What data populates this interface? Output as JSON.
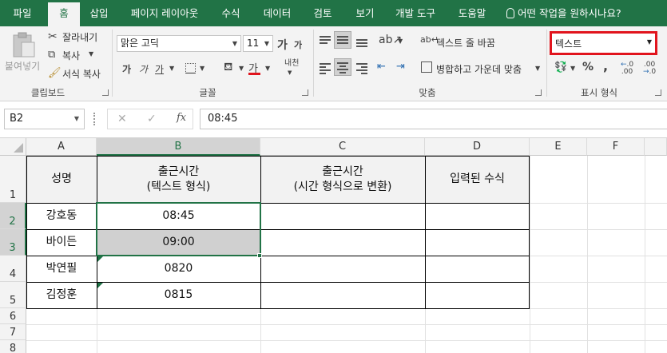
{
  "tabs": [
    "파일",
    "홈",
    "삽입",
    "페이지 레이아웃",
    "수식",
    "데이터",
    "검토",
    "보기",
    "개발 도구",
    "도움말"
  ],
  "active_tab": "홈",
  "tell_me": "어떤 작업을 원하시나요?",
  "clipboard": {
    "paste": "붙여넣기",
    "cut": "잘라내기",
    "copy": "복사",
    "format_painter": "서식 복사",
    "group": "클립보드"
  },
  "font": {
    "name": "맑은 고딕",
    "size": "11",
    "grow": "가",
    "shrink": "가",
    "bold": "가",
    "italic": "가",
    "underline": "가",
    "font_color": "가",
    "phonetic": "내천",
    "group": "글꼴"
  },
  "alignment": {
    "wrap_text": "텍스트 줄 바꿈",
    "merge_center": "병합하고 가운데 맞춤",
    "group": "맞춤"
  },
  "number": {
    "format": "텍스트",
    "percent": "%",
    "comma": ",",
    "inc_decimal": ".00",
    "dec_decimal": ".0",
    "group": "표시 형식"
  },
  "formula_bar": {
    "name_box": "B2",
    "formula": "08:45",
    "fx": "fx"
  },
  "columns": [
    "A",
    "B",
    "C",
    "D",
    "E",
    "F"
  ],
  "rows": [
    "1",
    "2",
    "3",
    "4",
    "5",
    "6",
    "7",
    "8"
  ],
  "table": {
    "headers": [
      "성명",
      "출근시간\n(텍스트 형식)",
      "출근시간\n(시간 형식으로 변환)",
      "입력된 수식"
    ],
    "rows": [
      [
        "강호동",
        "08:45",
        "",
        ""
      ],
      [
        "바이든",
        "09:00",
        "",
        ""
      ],
      [
        "박연필",
        "0820",
        "",
        ""
      ],
      [
        "김정훈",
        "0815",
        "",
        ""
      ]
    ]
  },
  "colors": {
    "brand": "#217346",
    "highlight_border": "#e1141d",
    "selected_cell_fill": "#d0d0d0"
  }
}
